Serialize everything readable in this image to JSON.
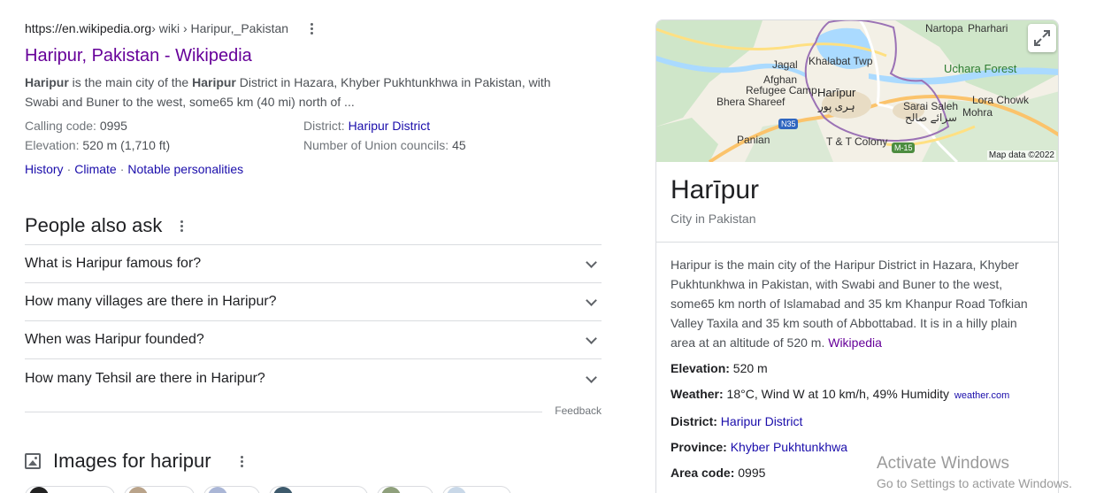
{
  "result": {
    "url_host": "https://en.wikipedia.org",
    "url_path": " › wiki › Haripur,_Pakistan",
    "title": "Haripur, Pakistan - Wikipedia",
    "snippet": {
      "b1": "Haripur",
      "t1": " is the main city of the ",
      "b2": "Haripur",
      "t2": " District in Hazara, Khyber Pukhtunkhwa in Pakistan, with Swabi and Buner to the west, some65 km (40 mi) north of ..."
    },
    "facts": {
      "calling_code_label": "Calling code: ",
      "calling_code": "0995",
      "district_label": "District: ",
      "district": "Haripur District",
      "elevation_label": "Elevation: ",
      "elevation": "520 m (1,710 ft)",
      "union_label": "Number of Union councils: ",
      "union": "45"
    },
    "sitelinks": [
      "History",
      "Climate",
      "Notable personalities"
    ],
    "sitelink_sep": "·"
  },
  "paa": {
    "title": "People also ask",
    "questions": [
      "What is Haripur famous for?",
      "How many villages are there in Haripur?",
      "When was Haripur founded?",
      "How many Tehsil are there in Haripur?"
    ],
    "feedback": "Feedback"
  },
  "images": {
    "title": "Images for haripur"
  },
  "knowledge_panel": {
    "map": {
      "labels": {
        "nartopa": "Nartopa",
        "pharhari": "Pharhari",
        "uchara": "Uchara Forest",
        "jagal": "Jagal",
        "khalabat": "Khalabat Twp",
        "afghan": "Afghan",
        "refugee": "Refugee Camp",
        "haripur": "Harīpur",
        "haripur_urdu": "ہری پور",
        "bhera": "Bhera Shareef",
        "sarai": "Sarai Saleh",
        "sarai_urdu": "سرائے صالح",
        "lora": "Lora Chowk",
        "mohra": "Mohra",
        "n35": "N35",
        "panian": "Panian",
        "tt_colony": "T & T Colony",
        "m15": "M-15"
      },
      "credit": "Map data ©2022"
    },
    "title": "Harīpur",
    "subtitle": "City in Pakistan",
    "description": "Haripur is the main city of the Haripur District in Hazara, Khyber Pukhtunkhwa in Pakistan, with Swabi and Buner to the west, some65 km north of Islamabad and 35 km Khanpur Road Tofkian Valley Taxila and 35 km south of Abbottabad. It is in a hilly plain area at an altitude of 520 m. ",
    "description_link": "Wikipedia",
    "facts": {
      "elevation_label": "Elevation:",
      "elevation": "520 m",
      "weather_label": "Weather:",
      "weather": "18°C, Wind W at 10 km/h, 49% Humidity",
      "weather_src": "weather.com",
      "district_label": "District:",
      "district": "Haripur District",
      "province_label": "Province:",
      "province": "Khyber Pukhtunkhwa",
      "area_label": "Area code:",
      "area": "0995"
    }
  },
  "watermark": {
    "line1": "Activate Windows",
    "line2": "Go to Settings to activate Windows."
  },
  "colors": {
    "link": "#1a0dab",
    "visited": "#660099",
    "text": "#202124",
    "muted": "#70757a",
    "divider": "#dadce0"
  }
}
